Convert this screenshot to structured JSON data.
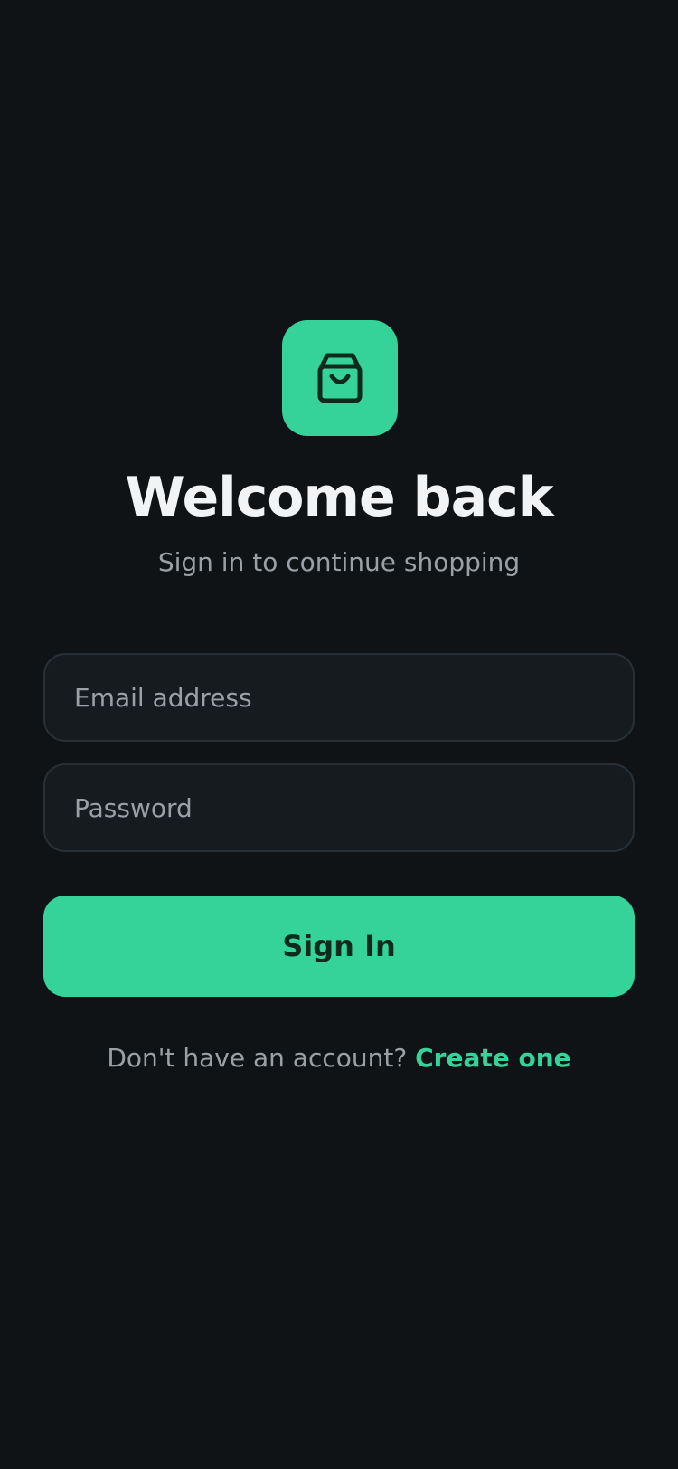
{
  "app": {
    "icon": "shopping-bag-icon",
    "accent_color": "#35d399",
    "background_color": "#0f1316"
  },
  "header": {
    "title": "Welcome back",
    "subtitle": "Sign in to continue shopping"
  },
  "form": {
    "email": {
      "placeholder": "Email address",
      "value": ""
    },
    "password": {
      "placeholder": "Password",
      "value": ""
    },
    "submit_label": "Sign In"
  },
  "footer": {
    "prompt": "Don't have an account?",
    "link_label": "Create one"
  }
}
